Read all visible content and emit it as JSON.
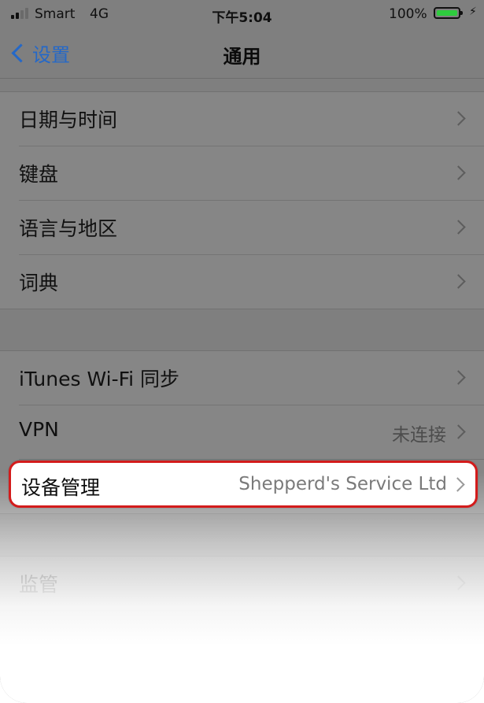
{
  "status_bar": {
    "carrier": "Smart",
    "network": "4G",
    "time": "下午5:04",
    "battery_percent": "100%",
    "battery_level": 1.0,
    "battery_color": "#2ecc3e",
    "signal_bars_filled": 2,
    "signal_bars_total": 4
  },
  "nav": {
    "back_label": "设置",
    "title": "通用",
    "accent_color": "#2468c8"
  },
  "group1": {
    "items": [
      {
        "label": "日期与时间"
      },
      {
        "label": "键盘"
      },
      {
        "label": "语言与地区"
      },
      {
        "label": "词典"
      }
    ]
  },
  "group2": {
    "items": [
      {
        "label": "iTunes Wi-Fi 同步"
      },
      {
        "label": "VPN",
        "value": "未连接"
      }
    ]
  },
  "highlight": {
    "label": "设备管理",
    "value": "Shepperd's Service Ltd",
    "border_color": "#d31b1b"
  },
  "group3": {
    "items": [
      {
        "label": "监管"
      }
    ]
  }
}
